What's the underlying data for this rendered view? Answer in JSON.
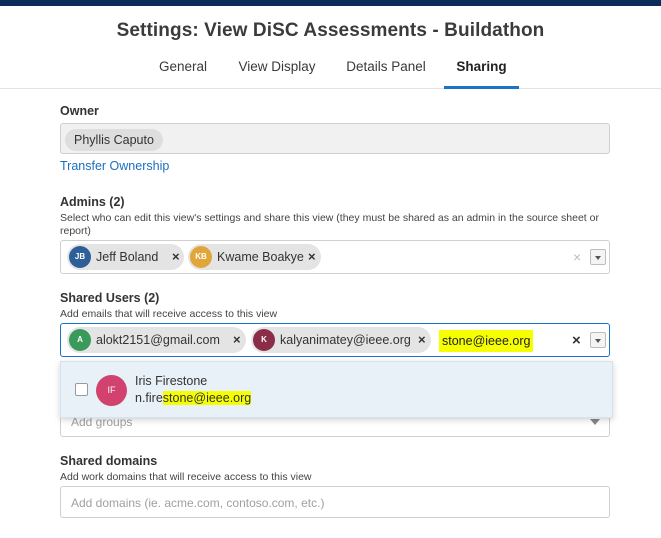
{
  "window_title": "Settings: View DiSC Assessments - Buildathon",
  "tabs": [
    {
      "label": "General"
    },
    {
      "label": "View Display"
    },
    {
      "label": "Details Panel"
    },
    {
      "label": "Sharing",
      "active": true
    }
  ],
  "owner": {
    "label": "Owner",
    "name": "Phyllis Caputo",
    "transfer_link": "Transfer Ownership"
  },
  "admins": {
    "label": "Admins (2)",
    "hint": "Select who can edit this view's settings and share this view (they must be shared as an admin in the source sheet or report)",
    "chips": [
      {
        "initials": "JB",
        "name": "Jeff Boland",
        "color": "#2f5f97"
      },
      {
        "initials": "KB",
        "name": "Kwame Boakye",
        "color": "#e0a63a"
      }
    ],
    "clear_symbol": "×"
  },
  "shared_users": {
    "label": "Shared Users (2)",
    "hint": "Add emails that will receive access to this view",
    "chips": [
      {
        "initials": "A",
        "name": "alokt2151@gmail.com",
        "color": "#3a9a5b"
      },
      {
        "initials": "K",
        "name": "kalyanimatey@ieee.org",
        "color": "#8b2c48"
      }
    ],
    "input_value": "stone@ieee.org",
    "clear_symbol": "×"
  },
  "suggestion": {
    "initials": "IF",
    "name": "Iris Firestone",
    "email_prefix": "n.fire",
    "email_match": "stone@ieee.org",
    "avatar_color": "#d2426f"
  },
  "shared_groups": {
    "placeholder": "Add groups"
  },
  "shared_domains": {
    "label": "Shared domains",
    "hint": "Add work domains that will receive access to this view",
    "placeholder": "Add domains (ie. acme.com, contoso.com, etc.)"
  },
  "chip_remove_symbol": "×",
  "colors": {
    "accent": "#1a73c8",
    "highlight": "#f6ff00",
    "topbar": "#0b2c5a"
  }
}
